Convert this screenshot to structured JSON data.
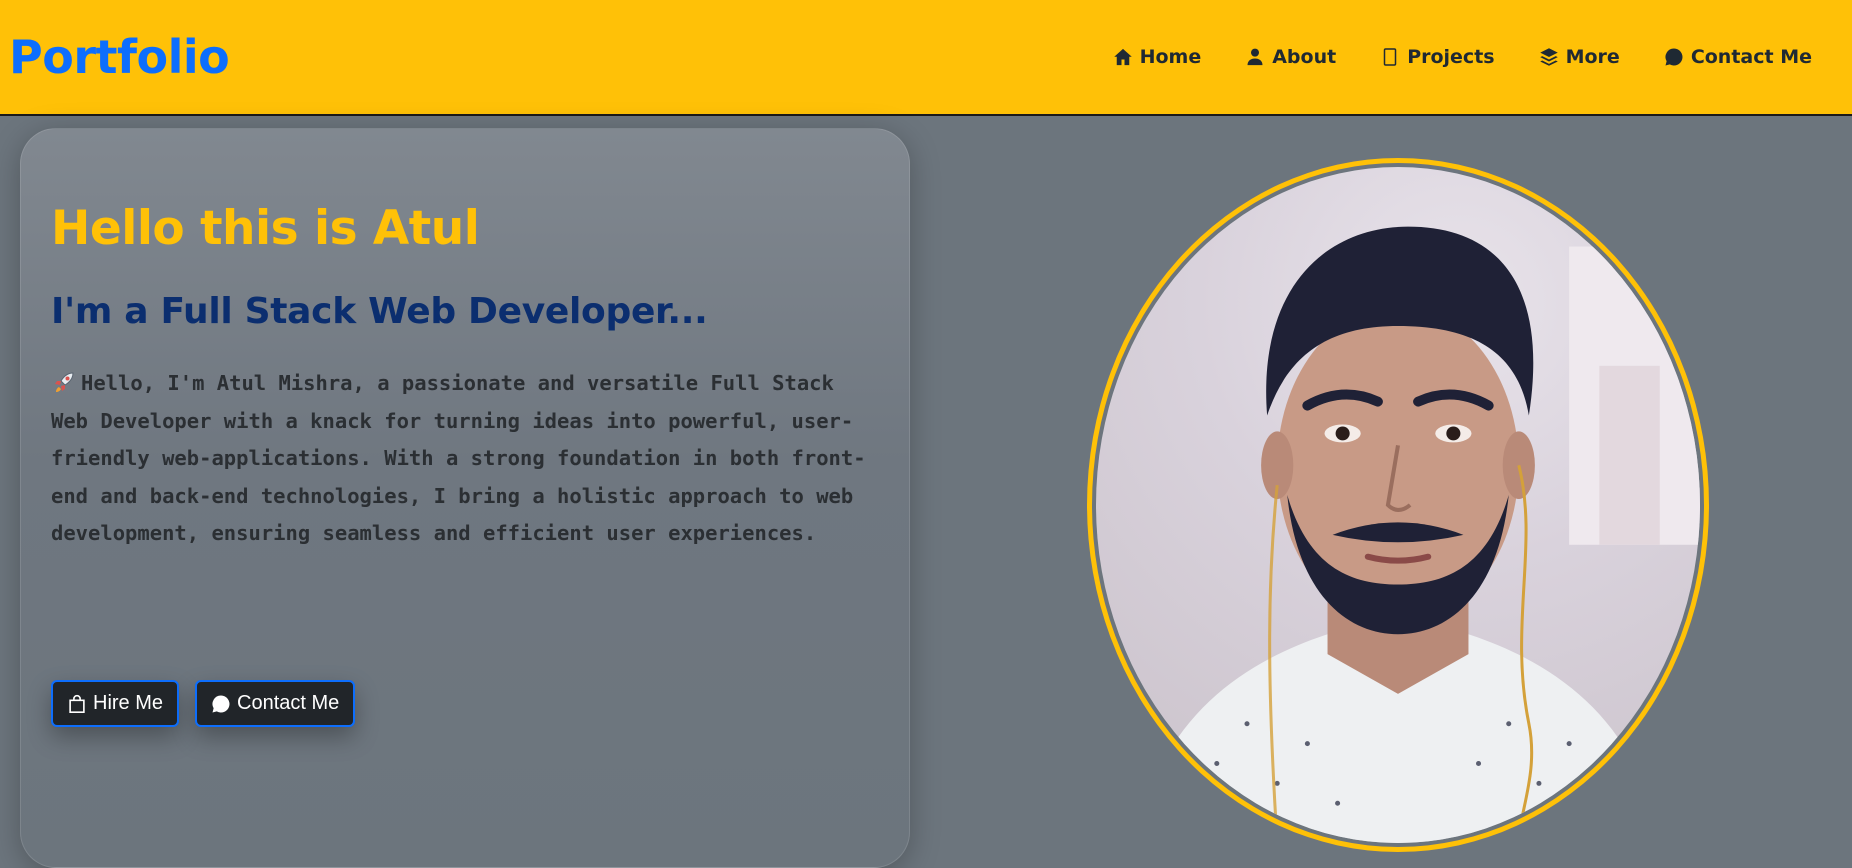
{
  "navbar": {
    "brand": "Portfolio",
    "links": [
      {
        "label": "Home",
        "icon": "home-icon"
      },
      {
        "label": "About",
        "icon": "person-icon"
      },
      {
        "label": "Projects",
        "icon": "phone-icon"
      },
      {
        "label": "More",
        "icon": "layers-icon"
      },
      {
        "label": "Contact Me",
        "icon": "chat-icon"
      }
    ]
  },
  "hero": {
    "greeting": "Hello this is Atul",
    "role": "I'm a Full Stack Web Developer...",
    "bio": "Hello, I'm Atul Mishra, a passionate and versatile Full Stack Web Developer with a knack for turning ideas into powerful, user-friendly web-applications. With a strong foundation in both front-end and back-end technologies, I bring a holistic approach to web development, ensuring seamless and efficient user experiences.",
    "bio_icon": "rocket-icon",
    "buttons": {
      "hire": "Hire Me",
      "contact": "Contact Me"
    }
  },
  "profile_photo": {
    "icon": "profile-photo"
  },
  "colors": {
    "navbar": "#ffc107",
    "brand": "#0d6efd",
    "background": "#6c757d",
    "heading": "#ffc107",
    "role": "#0b2e6f",
    "button_bg": "#212529",
    "button_border": "#0d6efd"
  }
}
